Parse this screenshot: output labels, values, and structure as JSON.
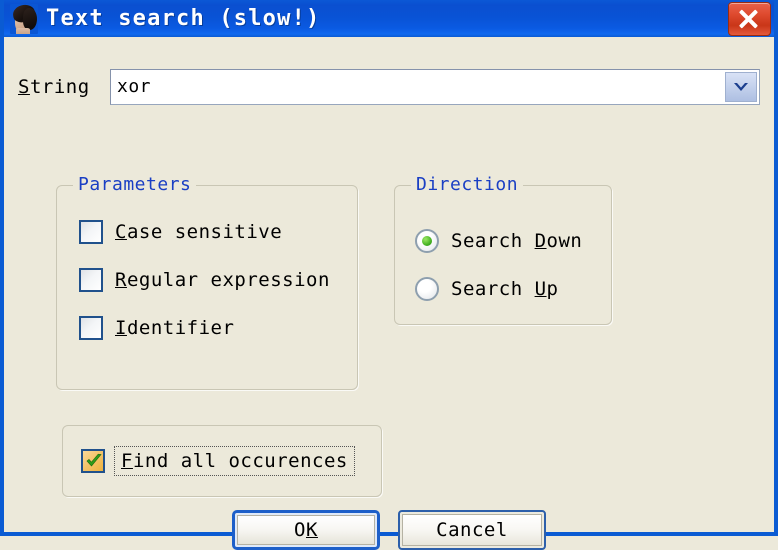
{
  "window": {
    "title": "Text search (slow!)",
    "icon": "person-photo-icon",
    "close_label": "×",
    "titlebar_color": "#0a52d4",
    "dialog_bg": "#ece9da"
  },
  "search": {
    "string_label_pre": "",
    "string_label_accel": "S",
    "string_label_post": "tring",
    "value": "xor",
    "placeholder": "",
    "dropdown_icon": "chevron-down-icon"
  },
  "parameters": {
    "legend": "Parameters",
    "legend_color": "#1a3fc4",
    "items": [
      {
        "pre": "",
        "accel": "C",
        "post": "ase sensitive",
        "checked": false
      },
      {
        "pre": "",
        "accel": "R",
        "post": "egular expression",
        "checked": false
      },
      {
        "pre": "",
        "accel": "I",
        "post": "dentifier",
        "checked": false
      }
    ]
  },
  "direction": {
    "legend": "Direction",
    "legend_color": "#1a3fc4",
    "options": [
      {
        "pre": "Search ",
        "accel": "D",
        "post": "own",
        "selected": true
      },
      {
        "pre": "Search ",
        "accel": "U",
        "post": "p",
        "selected": false
      }
    ]
  },
  "findall": {
    "pre": "",
    "accel": "F",
    "post": "ind all occurences",
    "checked": true,
    "focused": true,
    "check_color": "#3fae1f"
  },
  "footer": {
    "ok": {
      "pre": "O",
      "accel": "K",
      "post": "",
      "default": true
    },
    "cancel": {
      "pre": "Cancel",
      "accel": "",
      "post": ""
    }
  }
}
